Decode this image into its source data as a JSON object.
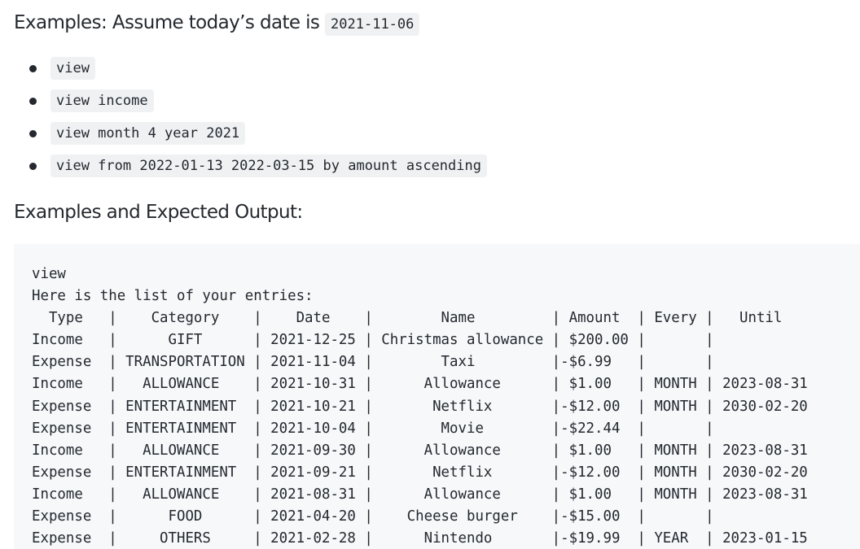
{
  "intro": {
    "label": "Examples: Assume today’s date is ",
    "date_code": "2021-11-06"
  },
  "examples": [
    "view",
    "view income",
    "view month 4 year 2021",
    "view from 2022-01-13 2022-03-15 by amount ascending"
  ],
  "section_title": "Examples and Expected Output:",
  "output_lines": [
    "view",
    "Here is the list of your entries:",
    "  Type   |    Category    |    Date    |        Name         | Amount  | Every |   Until",
    "Income   |      GIFT      | 2021-12-25 | Christmas allowance | $200.00 |       |",
    "Expense  | TRANSPORTATION | 2021-11-04 |        Taxi         |-$6.99   |       |",
    "Income   |   ALLOWANCE    | 2021-10-31 |      Allowance      | $1.00   | MONTH | 2023-08-31",
    "Expense  | ENTERTAINMENT  | 2021-10-21 |       Netflix       |-$12.00  | MONTH | 2030-02-20",
    "Expense  | ENTERTAINMENT  | 2021-10-04 |        Movie        |-$22.44  |       |",
    "Income   |   ALLOWANCE    | 2021-09-30 |      Allowance      | $1.00   | MONTH | 2023-08-31",
    "Expense  | ENTERTAINMENT  | 2021-09-21 |       Netflix       |-$12.00  | MONTH | 2030-02-20",
    "Income   |   ALLOWANCE    | 2021-08-31 |      Allowance      | $1.00   | MONTH | 2023-08-31",
    "Expense  |      FOOD      | 2021-04-20 |    Cheese burger    |-$15.00  |       |",
    "Expense  |     OTHERS     | 2021-02-28 |      Nintendo       |-$19.99  | YEAR  | 2023-01-15"
  ]
}
